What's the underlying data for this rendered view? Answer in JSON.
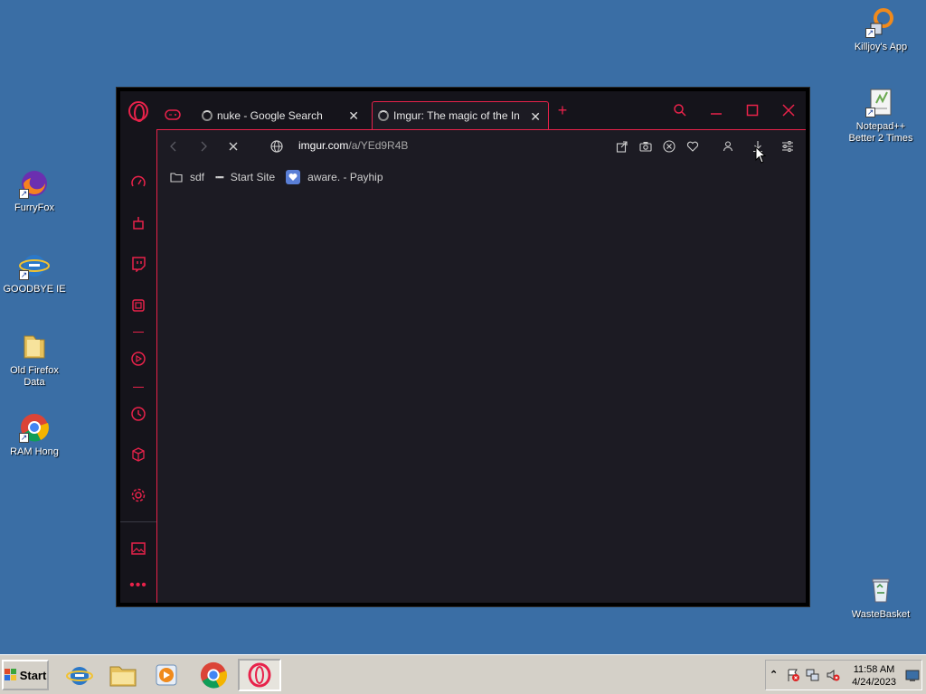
{
  "desktop": {
    "icons": [
      {
        "label": "Killjoy's App"
      },
      {
        "label": "Notepad++\nBetter 2 Times"
      },
      {
        "label": "FurryFox"
      },
      {
        "label": "GOODBYE IE"
      },
      {
        "label": "Old Firefox\nData"
      },
      {
        "label": "RAM Hong"
      },
      {
        "label": "WasteBasket"
      }
    ]
  },
  "browser": {
    "tabs": [
      {
        "title": "nuke - Google Search"
      },
      {
        "title": "Imgur: The magic of the Internet"
      }
    ],
    "address": {
      "host": "imgur.com",
      "path": "/a/YEd9R4B"
    },
    "bookmarks": [
      {
        "label": "sdf"
      },
      {
        "label": "Start Site"
      },
      {
        "label": "aware. - Payhip"
      }
    ],
    "accent_color": "#e8224a"
  },
  "taskbar": {
    "start_label": "Start",
    "clock_time": "11:58 AM",
    "clock_date": "4/24/2023"
  }
}
